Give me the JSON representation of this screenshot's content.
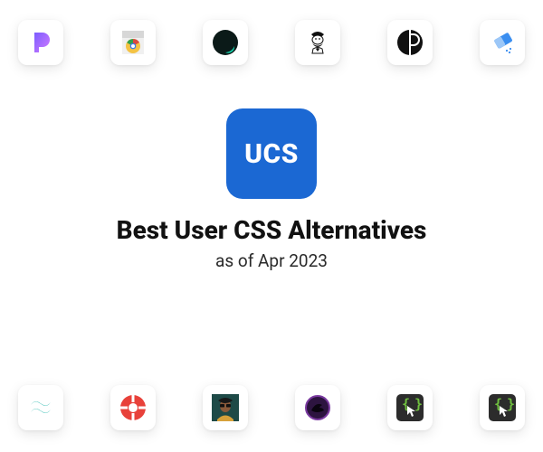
{
  "hero": {
    "icon_text": "UCS",
    "title": "Best User CSS Alternatives",
    "subtitle": "as of Apr 2023"
  },
  "top_icons": [
    {
      "name": "pandora-icon"
    },
    {
      "name": "chrome-store-icon"
    },
    {
      "name": "dark-circle-icon"
    },
    {
      "name": "gentleman-icon"
    },
    {
      "name": "p-circle-icon"
    },
    {
      "name": "eraser-icon"
    }
  ],
  "bottom_icons": [
    {
      "name": "tailwind-icon"
    },
    {
      "name": "lifesaver-icon"
    },
    {
      "name": "portrait-icon"
    },
    {
      "name": "bird-circle-icon"
    },
    {
      "name": "code-cursor-icon"
    },
    {
      "name": "code-cursor-alt-icon"
    }
  ]
}
